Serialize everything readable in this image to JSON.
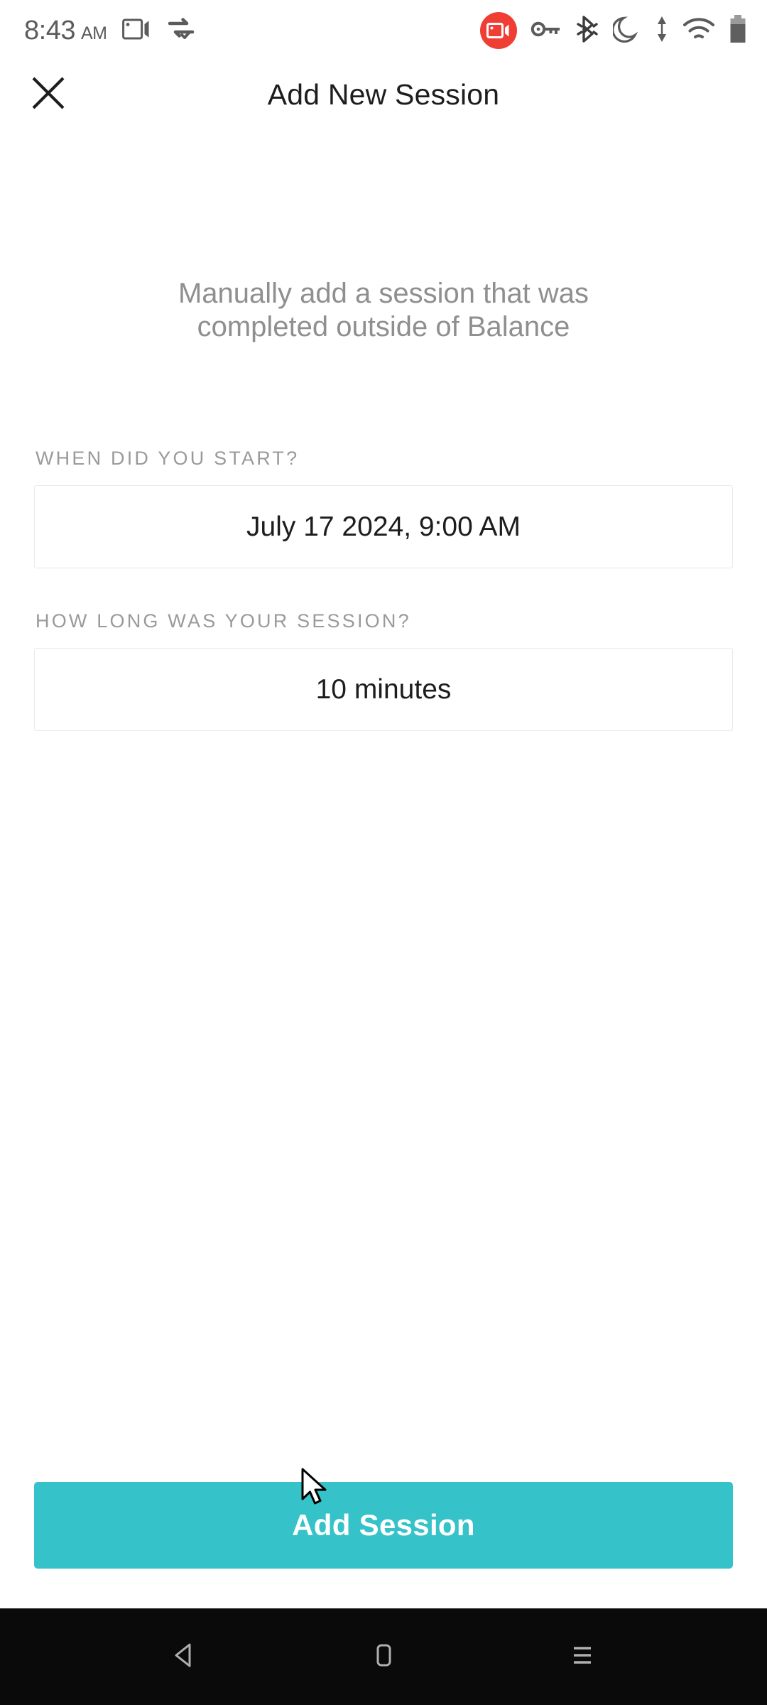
{
  "status_bar": {
    "time": "8:43",
    "ampm": "AM",
    "icons_left": [
      "screen-cast-icon",
      "data-saver-icon"
    ],
    "icons_right": [
      "screen-record-icon",
      "vpn-key-icon",
      "bluetooth-icon",
      "do-not-disturb-icon",
      "data-transfer-icon",
      "wifi-icon",
      "battery-icon"
    ],
    "record_badge_color": "#EF3E33"
  },
  "header": {
    "title": "Add New Session",
    "close_icon": "close-icon"
  },
  "main": {
    "subtitle_line1": "Manually add a session that was",
    "subtitle_line2": "completed outside of Balance",
    "fields": [
      {
        "label": "WHEN DID YOU START?",
        "value": "July 17 2024, 9:00 AM",
        "name": "start-datetime"
      },
      {
        "label": "HOW LONG WAS YOUR SESSION?",
        "value": "10 minutes",
        "name": "session-duration"
      }
    ]
  },
  "cta": {
    "label": "Add Session",
    "color": "#35C2C8"
  },
  "nav_bar": {
    "back": "back-icon",
    "home": "home-icon",
    "recents": "recents-icon"
  }
}
